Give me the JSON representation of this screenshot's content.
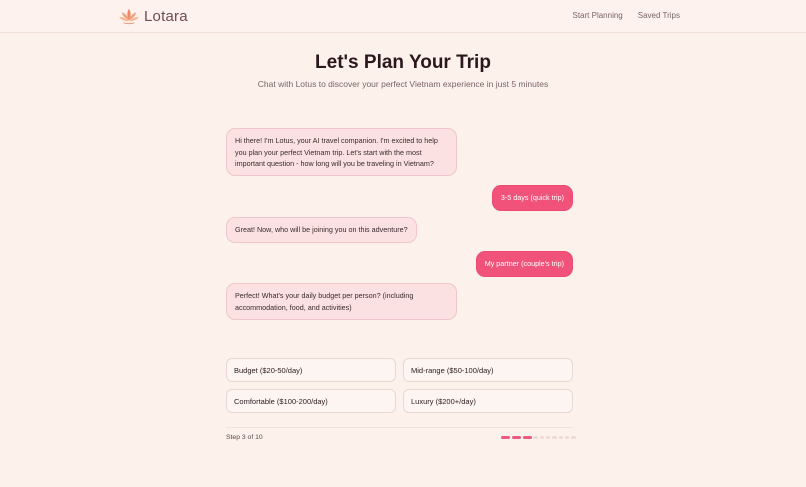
{
  "header": {
    "brand": "Lotara",
    "nav": [
      "Start Planning",
      "Saved Trips"
    ]
  },
  "hero": {
    "title": "Let's Plan Your Trip",
    "subtitle": "Chat with Lotus to discover your perfect Vietnam experience in just 5 minutes"
  },
  "chat": {
    "messages": [
      {
        "from": "bot",
        "text": "Hi there! I'm Lotus, your AI travel companion. I'm excited to help you plan your perfect Vietnam trip. Let's start with the most important question - how long will you be traveling in Vietnam?"
      },
      {
        "from": "user",
        "text": "3-5 days (quick trip)"
      },
      {
        "from": "bot",
        "text": "Great! Now, who will be joining you on this adventure?"
      },
      {
        "from": "user",
        "text": "My partner (couple's trip)"
      },
      {
        "from": "bot",
        "text": "Perfect! What's your daily budget per person? (including accommodation, food, and activities)"
      }
    ]
  },
  "options": [
    "Budget ($20-50/day)",
    "Mid-range ($50-100/day)",
    "Comfortable ($100-200/day)",
    "Luxury ($200+/day)"
  ],
  "progress": {
    "label": "Step 3 of 10",
    "current": 3,
    "total": 10
  },
  "colors": {
    "accent": "#f0527a",
    "background": "#fdf1ec",
    "bot_bubble": "#fbe1e2"
  },
  "icons": {
    "logo": "lotus-icon"
  }
}
